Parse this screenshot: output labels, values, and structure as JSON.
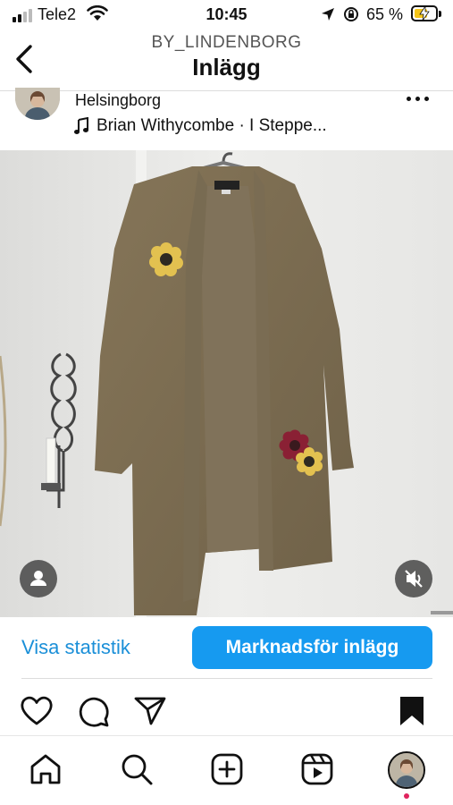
{
  "status_bar": {
    "carrier": "Tele2",
    "time": "10:45",
    "battery_percent": "65 %",
    "battery_level": 0.65
  },
  "header": {
    "account": "BY_LINDENBORG",
    "title": "Inlägg"
  },
  "post": {
    "location": "Helsingborg",
    "music": "Brian Withycombe · I Steppe..."
  },
  "actions": {
    "stats_label": "Visa statistik",
    "promote_label": "Marknadsför inlägg"
  },
  "icons": {
    "back": "chevron-left-icon",
    "like": "heart-icon",
    "comment": "comment-icon",
    "share": "send-icon",
    "save": "bookmark-icon",
    "home": "home-icon",
    "search": "search-icon",
    "create": "plus-square-icon",
    "reels": "reels-icon",
    "tag": "person-tag-icon",
    "mute": "speaker-muted-icon"
  },
  "colors": {
    "accent": "#169af0",
    "link": "#1a8fd8",
    "battery": "#f5c518"
  }
}
